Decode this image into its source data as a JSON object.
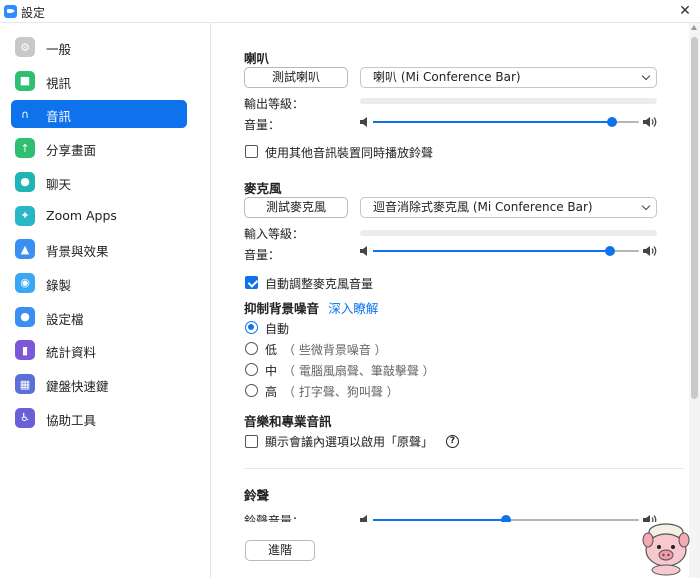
{
  "window": {
    "title": "設定",
    "close_glyph": "✕"
  },
  "sidebar": {
    "items": [
      {
        "label": "一般",
        "icon": "gear-icon",
        "color": "#c8c8c8",
        "glyph": "⚙",
        "active": false
      },
      {
        "label": "視訊",
        "icon": "video-icon",
        "color": "#2fbf71",
        "glyph": "■",
        "active": false
      },
      {
        "label": "音訊",
        "icon": "headphones-icon",
        "color": "#0e72ed",
        "glyph": "∩",
        "active": true
      },
      {
        "label": "分享畫面",
        "icon": "share-screen-icon",
        "color": "#2fbf71",
        "glyph": "↑",
        "active": false
      },
      {
        "label": "聊天",
        "icon": "chat-icon",
        "color": "#1fb5b5",
        "glyph": "●",
        "active": false
      },
      {
        "label": "Zoom Apps",
        "icon": "apps-icon",
        "color": "#29b6c7",
        "glyph": "✦",
        "active": false
      },
      {
        "label": "背景與效果",
        "icon": "background-effects-icon",
        "color": "#3a8ff0",
        "glyph": "▲",
        "active": false
      },
      {
        "label": "錄製",
        "icon": "record-icon",
        "color": "#39a8f2",
        "glyph": "◉",
        "active": false
      },
      {
        "label": "設定檔",
        "icon": "profile-icon",
        "color": "#3a8ff0",
        "glyph": "●",
        "active": false
      },
      {
        "label": "統計資料",
        "icon": "statistics-icon",
        "color": "#7d57d8",
        "glyph": "▮",
        "active": false
      },
      {
        "label": "鍵盤快速鍵",
        "icon": "keyboard-icon",
        "color": "#5b6fd9",
        "glyph": "▦",
        "active": false
      },
      {
        "label": "協助工具",
        "icon": "accessibility-icon",
        "color": "#6b5fd8",
        "glyph": "♿",
        "active": false
      }
    ]
  },
  "speaker": {
    "title": "喇叭",
    "test_button": "測試喇叭",
    "device": "喇叭 (Mi Conference Bar)",
    "output_level_label": "輸出等級：",
    "volume_label": "音量：",
    "volume": 0.9,
    "separate_device_label": "使用其他音訊裝置同時播放鈴聲",
    "separate_device_checked": false
  },
  "microphone": {
    "title": "麥克風",
    "test_button": "測試麥克風",
    "device": "迴音消除式麥克風 (Mi Conference Bar)",
    "input_level_label": "輸入等級：",
    "volume_label": "音量：",
    "volume": 0.89,
    "auto_adjust_label": "自動調整麥克風音量",
    "auto_adjust_checked": true
  },
  "noise": {
    "title": "抑制背景噪音",
    "learn_more": "深入瞭解",
    "options": [
      {
        "label": "自動",
        "hint": "",
        "selected": true
      },
      {
        "label": "低",
        "hint": "（ 些微背景噪音 ）",
        "selected": false
      },
      {
        "label": "中",
        "hint": "（ 電腦風扇聲、筆敲擊聲 ）",
        "selected": false
      },
      {
        "label": "高",
        "hint": "（ 打字聲、狗叫聲 ）",
        "selected": false
      }
    ]
  },
  "music": {
    "title": "音樂和專業音訊",
    "original_sound_label": "顯示會議內選項以啟用「原聲」",
    "original_sound_checked": false,
    "help_glyph": "?"
  },
  "ringtone": {
    "title": "鈴聲",
    "volume_label": "鈴聲音量：",
    "volume": 0.5
  },
  "advanced_button": "進階",
  "colors": {
    "accent": "#0e72ed",
    "track": "#b5b5b5"
  }
}
